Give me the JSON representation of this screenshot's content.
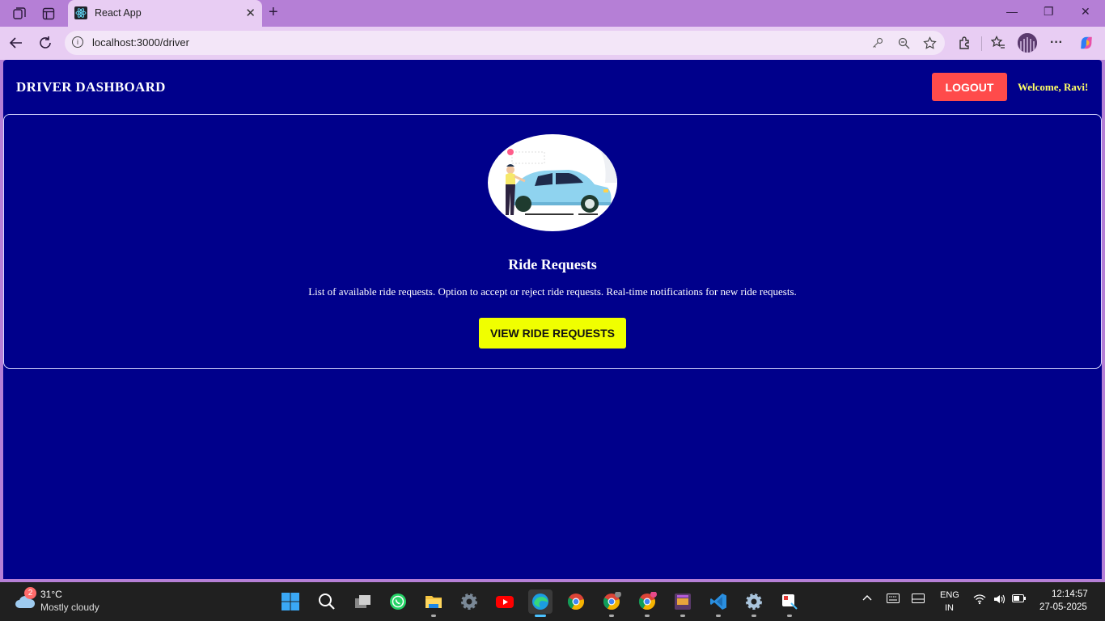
{
  "browser": {
    "tab_title": "React App",
    "url": "localhost:3000/driver"
  },
  "header": {
    "brand": "DRIVER DASHBOARD",
    "logout_label": "LOGOUT",
    "welcome": "Welcome, Ravi!"
  },
  "card": {
    "title": "Ride Requests",
    "description": "List of available ride requests. Option to accept or reject ride requests. Real-time notifications for new ride requests.",
    "button_label": "VIEW RIDE REQUESTS"
  },
  "taskbar": {
    "weather_badge": "2",
    "temperature": "31°C",
    "weather_desc": "Mostly cloudy",
    "lang_line1": "ENG",
    "lang_line2": "IN",
    "time": "12:14:57",
    "date": "27-05-2025"
  },
  "colors": {
    "page_bg": "#00008b",
    "logout_bg": "#ff4b4b",
    "view_button_bg": "#f0ff00",
    "welcome_text": "#ffff66",
    "browser_frame": "#b57fd6"
  }
}
